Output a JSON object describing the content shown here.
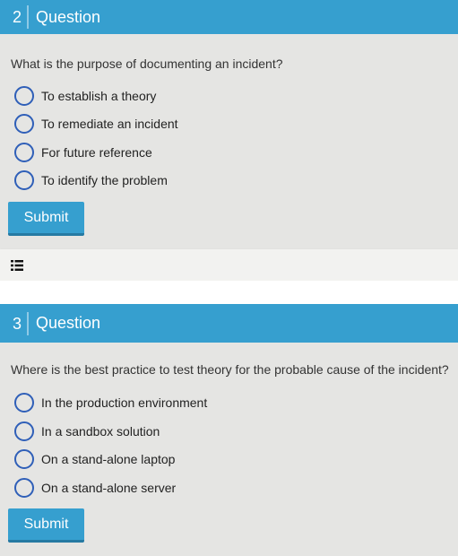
{
  "questions": [
    {
      "number": "2",
      "header": "Question",
      "text": "What is the purpose of documenting an incident?",
      "options": [
        "To establish a theory",
        "To remediate an incident",
        "For future reference",
        "To identify the problem"
      ],
      "submit_label": "Submit"
    },
    {
      "number": "3",
      "header": "Question",
      "text": "Where is the best practice to test theory for the probable cause of the incident?",
      "options": [
        "In the production environment",
        "In a sandbox solution",
        "On a stand-alone laptop",
        "On a stand-alone server"
      ],
      "submit_label": "Submit"
    }
  ],
  "toolbar": {
    "icon": "list-icon"
  },
  "colors": {
    "accent": "#369fcf",
    "radio": "#2f5fb8",
    "background": "#e5e5e3"
  }
}
